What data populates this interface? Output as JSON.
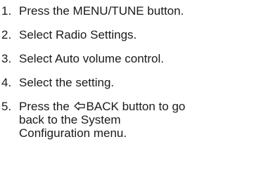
{
  "steps": [
    {
      "number": "1.",
      "text": "Press the MENU/TUNE button."
    },
    {
      "number": "2.",
      "text": "Select Radio Settings."
    },
    {
      "number": "3.",
      "text": "Select Auto volume control."
    },
    {
      "number": "4.",
      "text": "Select the setting."
    },
    {
      "number": "5.",
      "text_before_icon": "Press the ",
      "icon": "back-arrow-icon",
      "line1_after_icon": "BACK button to go",
      "line2": "back to the System",
      "line3": "Configuration menu."
    }
  ]
}
